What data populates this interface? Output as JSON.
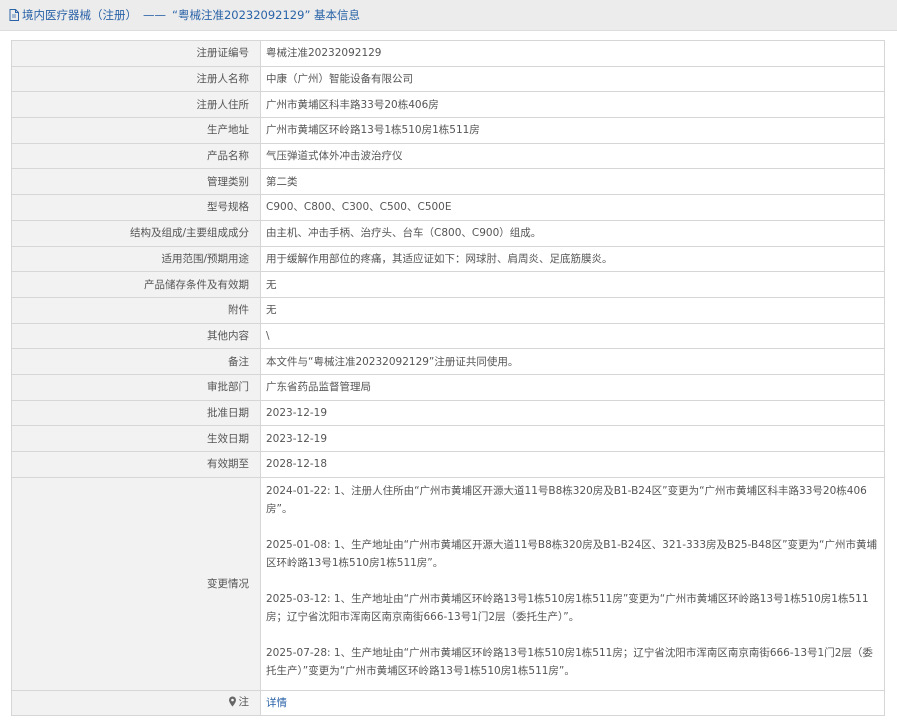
{
  "header": {
    "icon": "document-icon",
    "category": "境内医疗器械（注册）",
    "separator": "——",
    "title": "“粤械注准20232092129” 基本信息"
  },
  "rows": [
    {
      "label": "注册证编号",
      "value": "粤械注准20232092129"
    },
    {
      "label": "注册人名称",
      "value": "中康（广州）智能设备有限公司"
    },
    {
      "label": "注册人住所",
      "value": "广州市黄埔区科丰路33号20栋406房"
    },
    {
      "label": "生产地址",
      "value": "广州市黄埔区环岭路13号1栋510房1栋511房"
    },
    {
      "label": "产品名称",
      "value": "气压弹道式体外冲击波治疗仪"
    },
    {
      "label": "管理类别",
      "value": "第二类"
    },
    {
      "label": "型号规格",
      "value": "C900、C800、C300、C500、C500E"
    },
    {
      "label": "结构及组成/主要组成成分",
      "value": "由主机、冲击手柄、治疗头、台车（C800、C900）组成。"
    },
    {
      "label": "适用范围/预期用途",
      "value": "用于缓解作用部位的疼痛，其适应证如下：网球肘、肩周炎、足底筋膜炎。"
    },
    {
      "label": "产品储存条件及有效期",
      "value": "无"
    },
    {
      "label": "附件",
      "value": "无"
    },
    {
      "label": "其他内容",
      "value": "\\"
    },
    {
      "label": "备注",
      "value": "本文件与“粤械注准20232092129”注册证共同使用。"
    },
    {
      "label": "审批部门",
      "value": "广东省药品监督管理局"
    },
    {
      "label": "批准日期",
      "value": "2023-12-19"
    },
    {
      "label": "生效日期",
      "value": "2023-12-19"
    },
    {
      "label": "有效期至",
      "value": "2028-12-18"
    }
  ],
  "changes": {
    "label": "变更情况",
    "entries": [
      "2024-01-22: 1、注册人住所由“广州市黄埔区开源大道11号B8栋320房及B1-B24区”变更为“广州市黄埔区科丰路33号20栋406房”。",
      "2025-01-08: 1、生产地址由“广州市黄埔区开源大道11号B8栋320房及B1-B24区、321-333房及B25-B48区”变更为“广州市黄埔区环岭路13号1栋510房1栋511房”。",
      "2025-03-12: 1、生产地址由“广州市黄埔区环岭路13号1栋510房1栋511房”变更为“广州市黄埔区环岭路13号1栋510房1栋511房；辽宁省沈阳市浑南区南京南街666-13号1门2层（委托生产）”。",
      "2025-07-28: 1、生产地址由“广州市黄埔区环岭路13号1栋510房1栋511房；辽宁省沈阳市浑南区南京南街666-13号1门2层（委托生产）”变更为“广州市黄埔区环岭路13号1栋510房1栋511房”。"
    ]
  },
  "note": {
    "icon": "pin-icon",
    "label": "注",
    "link_text": "详情"
  }
}
